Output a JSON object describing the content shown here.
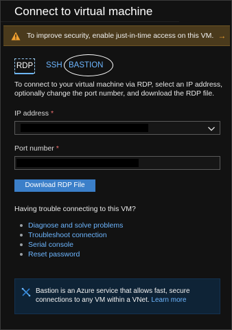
{
  "title": "Connect to virtual machine",
  "warning": {
    "text": "To improve security, enable just-in-time access on this VM.",
    "arrow": "→",
    "color": "#4a3a1c"
  },
  "tabs": [
    {
      "label": "RDP",
      "selected": true
    },
    {
      "label": "SSH",
      "selected": false
    },
    {
      "label": "BASTION",
      "selected": false
    }
  ],
  "description": "To connect to your virtual machine via RDP, select an IP address, optionally change the port number, and download the RDP file.",
  "ip_address": {
    "label": "IP address",
    "required_marker": "*",
    "value": ""
  },
  "port_number": {
    "label": "Port number",
    "required_marker": "*",
    "value": ""
  },
  "download_button": "Download RDP File",
  "trouble": {
    "heading": "Having trouble connecting to this VM?",
    "links": [
      "Diagnose and solve problems",
      "Troubleshoot connection",
      "Serial console",
      "Reset password"
    ]
  },
  "info": {
    "text": "Bastion is an Azure service that allows fast, secure connections to any VM within a VNet.",
    "link": "Learn more"
  },
  "colors": {
    "accent": "#6db6ff",
    "button": "#3b7fc9",
    "warning_icon": "#f0a030",
    "required": "#f07070"
  }
}
